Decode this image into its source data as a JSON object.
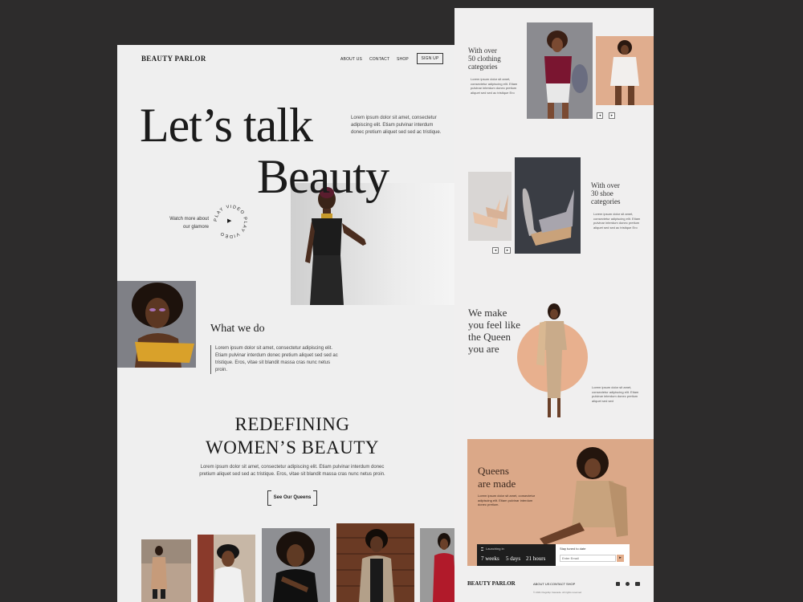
{
  "brand": "BEAUTY PARLOR",
  "nav": {
    "about": "ABOUT US",
    "contact": "CONTACT",
    "shop": "SHOP",
    "signup": "SIGN UP"
  },
  "hero": {
    "line1": "Let’s talk",
    "line2": "Beauty",
    "intro": "Lorem ipsum dolor sit amet, consectetur adipiscing elit. Etiam pulvinar interdum donec pretium aliquet sed sed ac tristique.",
    "watch_line1": "Watch more about",
    "watch_line2": "our glamore",
    "play_ring": "PLAY VIDEO PLAY VIDEO"
  },
  "what_we_do": {
    "title": "What we do",
    "text": "Lorem ipsum dolor sit amet, consectetur adipiscing elit. Etiam pulvinar interdum donec pretium aliquet sed sed ac tristique. Eros, vitae sit blandit massa cras nunc netus proin."
  },
  "redefining": {
    "line1": "REDEFINING",
    "line2": "WOMEN’S BEAUTY",
    "text": "Lorem ipsum dolor sit amet, consectetur adipiscing elit. Etiam pulvinar interdum donec pretium aliquet sed sed ac tristique. Eros, vitae sit blandit massa cras nunc netus proin.",
    "cta": "See Our Queens"
  },
  "clothing": {
    "title_l1": "With over",
    "title_l2": "50 clothing",
    "title_l3": "categories",
    "text": "Lorem ipsum dolor sit amet, consectetur adipiscing elit. Etiam pulvinar interdum donec pretium aliquet sed sed ac tristique Ero"
  },
  "shoes": {
    "title_l1": "With over",
    "title_l2": "30 shoe",
    "title_l3": "categories",
    "text": "Lorem ipsum dolor sit amet, consectetur adipiscing elit. Etiam pulvinar interdum donec pretium aliquet sed sed ac tristique Ero"
  },
  "queen": {
    "l1": "We make",
    "l2": "you feel like",
    "l3": "the Queen",
    "l4": "you are",
    "text": "Lorem ipsum dolor sit amet, consectetur adipiscing elit. Etiam pulvinar interdum donec pretium aliquet sed sed"
  },
  "queens_made": {
    "l1": "Queens",
    "l2": "are made",
    "text": "Lorem ipsum dolor sit amet, consectetur adipiscing elit. Etiam pulvinar interdum donec pretium.",
    "launch_label": "Launching in",
    "weeks": "7 weeks",
    "days": "5 days",
    "hours": "21 hours",
    "signup_label": "Stay tuned to date",
    "email_placeholder": "Enter Email"
  },
  "footer": {
    "brand": "BEAUTY PARLOR",
    "about": "ABOUT US",
    "contact": "CONTACT",
    "shop": "SHOP",
    "copyright": "© 2021 Flagship Cascade. All rights reserved"
  },
  "arrows": {
    "prev": "◂",
    "next": "▸",
    "submit": "▸",
    "play": "▶"
  },
  "icons": {
    "hourglass": "hourglass-icon",
    "social": [
      "instagram-icon",
      "twitter-icon",
      "youtube-icon"
    ]
  },
  "colors": {
    "page": "#efefef",
    "backdrop": "#2d2c2c",
    "peach": "#e8b08e",
    "dark": "#1e1e1e",
    "peach_panel": "#dba888"
  }
}
